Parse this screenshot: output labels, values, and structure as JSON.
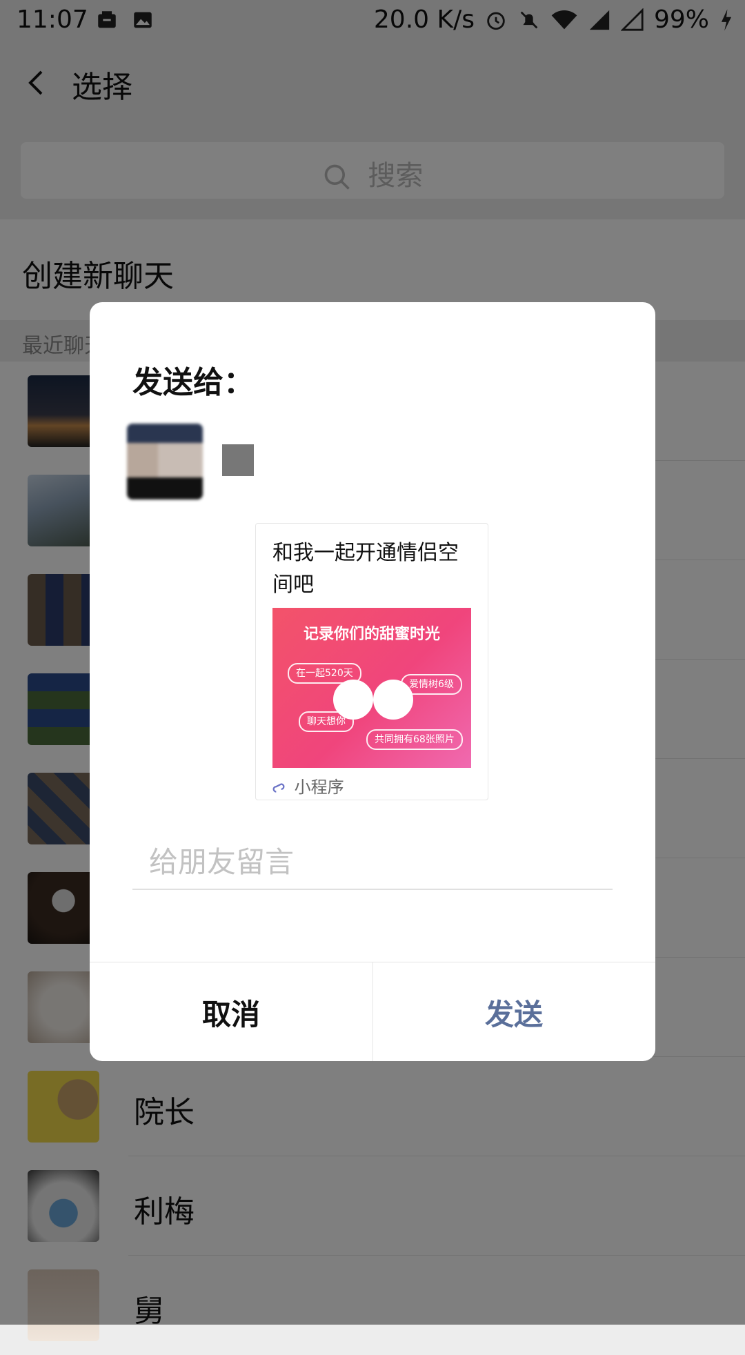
{
  "status_bar": {
    "time": "11:07",
    "net_speed": "20.0 K/s",
    "battery": "99%"
  },
  "header": {
    "title": "选择",
    "search_placeholder": "搜索"
  },
  "new_chat": {
    "label": "创建新聊天"
  },
  "section": {
    "label": "最近聊天"
  },
  "list": {
    "items": [
      {
        "name": ""
      },
      {
        "name": ""
      },
      {
        "name": ""
      },
      {
        "name": ""
      },
      {
        "name": ""
      },
      {
        "name": ""
      },
      {
        "name": ""
      },
      {
        "name": "院长"
      },
      {
        "name": "利梅"
      },
      {
        "name": "舅"
      }
    ]
  },
  "dialog": {
    "title": "发送给：",
    "card": {
      "title": "和我一起开通情侣空间吧",
      "image_headline": "记录你们的甜蜜时光",
      "pills": [
        "在一起520天",
        "爱情树6级",
        "聊天想你",
        "共同拥有68张照片"
      ],
      "footer": "小程序"
    },
    "message_placeholder": "给朋友留言",
    "cancel": "取消",
    "send": "发送"
  },
  "colors": {
    "accent_send": "#5a6f9a",
    "card_gradient": [
      "#f3536a",
      "#f06ab0"
    ]
  }
}
